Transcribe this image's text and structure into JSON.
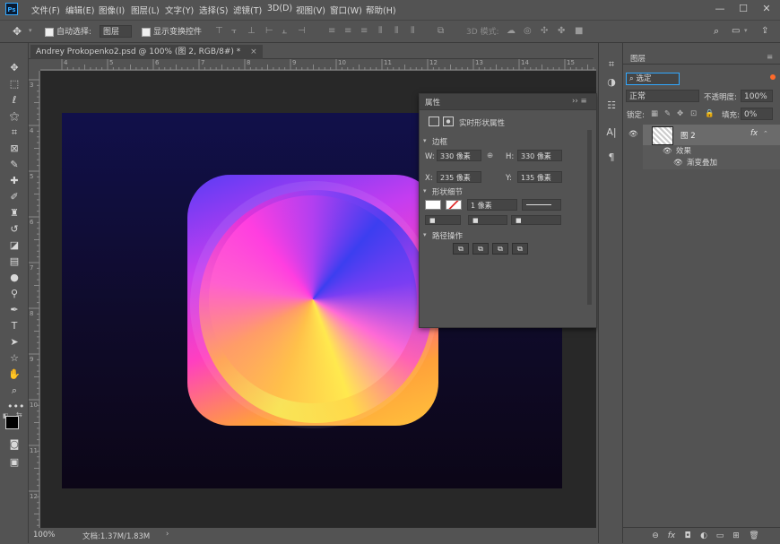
{
  "app": {
    "logo": "Ps"
  },
  "menu": [
    "文件(F)",
    "编辑(E)",
    "图像(I)",
    "图层(L)",
    "文字(Y)",
    "选择(S)",
    "滤镜(T)",
    "3D(D)",
    "视图(V)",
    "窗口(W)",
    "帮助(H)"
  ],
  "window_controls": {
    "minimize": "—",
    "maximize": "☐",
    "close": "✕"
  },
  "options": {
    "auto_select_label": "自动选择:",
    "auto_select_target": "图层",
    "show_transform_label": "显示变换控件",
    "mode_3d_label": "3D 模式:"
  },
  "document": {
    "tab_title": "Andrey Prokopenko2.psd @ 100% (图 2, RGB/8#) *",
    "tab_close": "×",
    "zoom": "100%",
    "doc_info": "文档:1.37M/1.83M",
    "status_arrow": "›",
    "ruler_h": [
      "4",
      "5",
      "6",
      "7",
      "8",
      "9",
      "10",
      "11",
      "12",
      "13",
      "14",
      "15"
    ],
    "ruler_v": [
      "3",
      "4",
      "5",
      "6",
      "7",
      "8",
      "9",
      "10",
      "11",
      "12"
    ]
  },
  "properties": {
    "tab": "属性",
    "menu_glyphs": "›› ≡",
    "header_label": "实时形状属性",
    "section_size": "边框",
    "w_label": "W:",
    "w_value": "330 像素",
    "link_glyph": "⊕",
    "h_label": "H:",
    "h_value": "330 像素",
    "x_label": "X:",
    "x_value": "235 像素",
    "y_label": "Y:",
    "y_value": "135 像素",
    "section_shape": "形状细节",
    "stroke_width": "1 像素",
    "section_path": "路径操作"
  },
  "layers": {
    "tab": "图层",
    "filter_label": "选定",
    "blend_mode": "正常",
    "opacity_label": "不透明度:",
    "opacity_value": "100%",
    "lock_label": "锁定:",
    "fill_label": "填充:",
    "fill_value": "0%",
    "layer_name": "图 2",
    "fx_label": "fx",
    "effects_label": "效果",
    "effect_name": "渐变叠加"
  },
  "colors": {
    "accent": "#31a8ff",
    "canvas_top": "#11104a",
    "canvas_bottom": "#0c0617"
  }
}
